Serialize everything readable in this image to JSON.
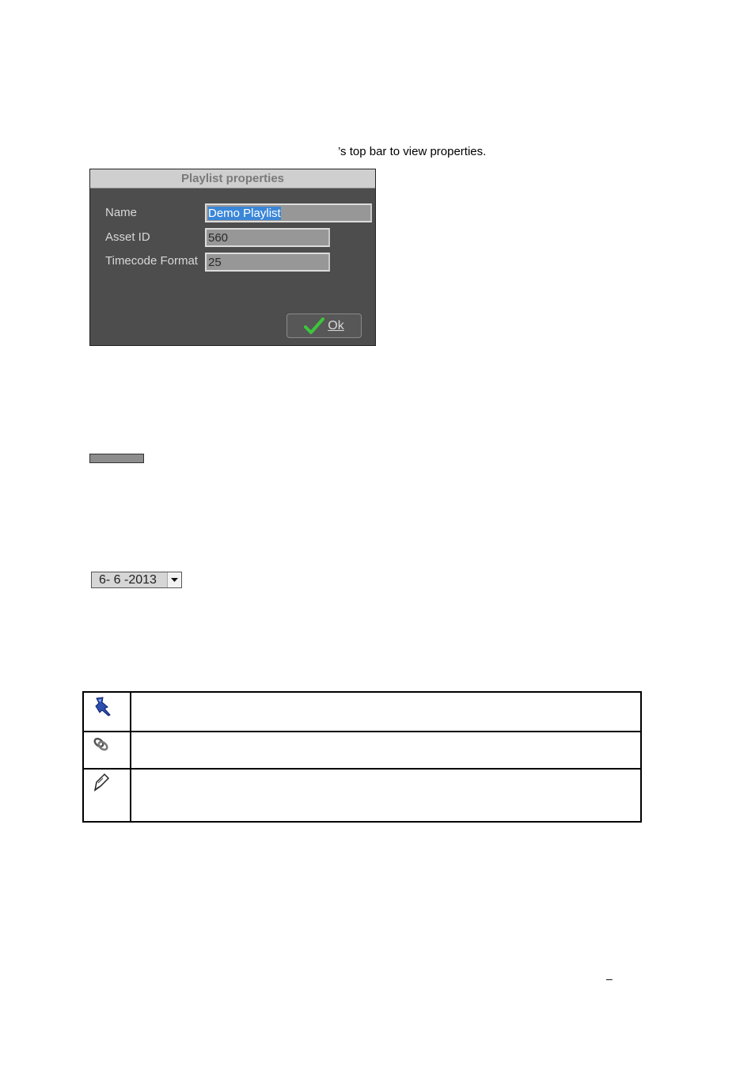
{
  "intro_text": "’s top bar to view properties.",
  "dialog": {
    "title": "Playlist properties",
    "fields": [
      {
        "label": "Name",
        "value": "Demo Playlist"
      },
      {
        "label": "Asset ID",
        "value": "560"
      },
      {
        "label": "Timecode Format",
        "value": "25"
      }
    ],
    "ok_label": "Ok"
  },
  "date_select": {
    "value": "6- 6 -2013"
  },
  "icon_table": [
    {
      "icon": "pushpin-icon",
      "text": ""
    },
    {
      "icon": "link-chain-icon",
      "text": ""
    },
    {
      "icon": "pen-edit-icon",
      "text": ""
    }
  ],
  "footer_mark": "–",
  "colors": {
    "dialog_bg": "#4d4d4d",
    "selection": "#3a86d8",
    "ok_check": "#3cc63c"
  }
}
